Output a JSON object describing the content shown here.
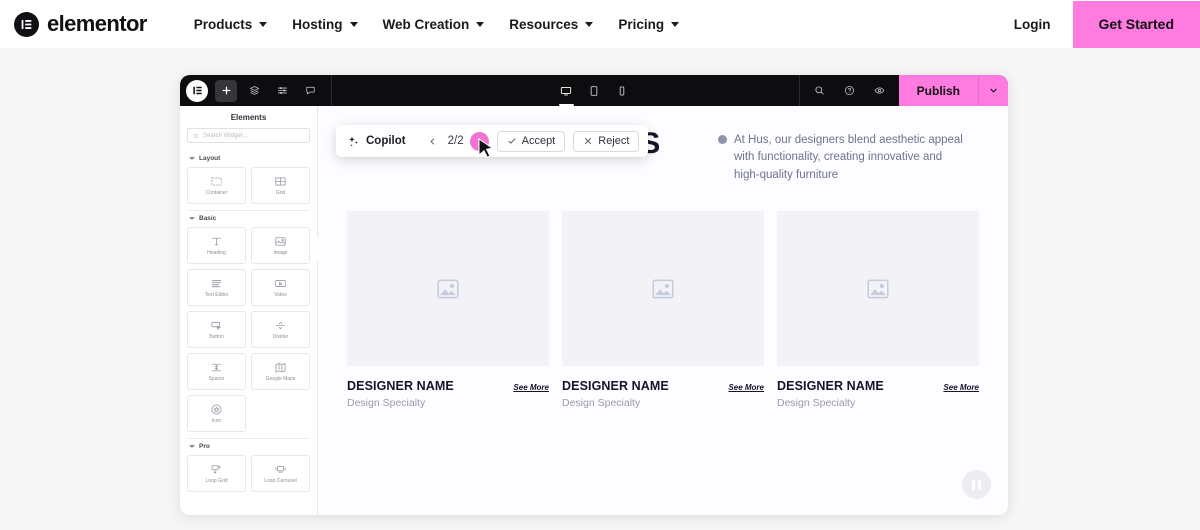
{
  "site_header": {
    "brand_name": "elementor",
    "brand_icon": "elementor-logo-icon",
    "nav": [
      {
        "label": "Products",
        "icon": "chevron-down-icon"
      },
      {
        "label": "Hosting",
        "icon": "chevron-down-icon"
      },
      {
        "label": "Web Creation",
        "icon": "chevron-down-icon"
      },
      {
        "label": "Resources",
        "icon": "chevron-down-icon"
      },
      {
        "label": "Pricing",
        "icon": "chevron-down-icon"
      }
    ],
    "login_label": "Login",
    "cta_label": "Get Started",
    "cta_color": "#ff7bdf"
  },
  "editor": {
    "topbar": {
      "logo_icon": "elementor-logo-icon",
      "add_icon": "plus-icon",
      "structure_icon": "layers-icon",
      "settings_icon": "sliders-icon",
      "comments_icon": "comment-bubble-icon",
      "devices": [
        {
          "name": "desktop",
          "icon": "desktop-icon",
          "active": true
        },
        {
          "name": "tablet",
          "icon": "tablet-icon",
          "active": false
        },
        {
          "name": "mobile",
          "icon": "mobile-icon",
          "active": false
        }
      ],
      "search_icon": "search-icon",
      "help_icon": "question-circle-icon",
      "preview_icon": "eye-icon",
      "publish_label": "Publish",
      "publish_caret_icon": "chevron-down-icon",
      "publish_color": "#ff7bdf"
    },
    "panel": {
      "title": "Elements",
      "search_placeholder": "Search Widget...",
      "search_icon": "search-icon",
      "collapse_icon": "chevron-left-icon",
      "sections": [
        {
          "title": "Layout",
          "widgets": [
            {
              "label": "Container",
              "icon": "container-icon"
            },
            {
              "label": "Grid",
              "icon": "grid-icon"
            }
          ]
        },
        {
          "title": "Basic",
          "widgets": [
            {
              "label": "Heading",
              "icon": "heading-icon"
            },
            {
              "label": "Image",
              "icon": "image-icon"
            },
            {
              "label": "Text Editor",
              "icon": "text-editor-icon"
            },
            {
              "label": "Video",
              "icon": "video-icon"
            },
            {
              "label": "Button",
              "icon": "button-icon"
            },
            {
              "label": "Divider",
              "icon": "divider-icon"
            },
            {
              "label": "Spacer",
              "icon": "spacer-icon"
            },
            {
              "label": "Google Maps",
              "icon": "google-maps-icon"
            },
            {
              "label": "Icon",
              "icon": "star-icon"
            }
          ]
        },
        {
          "title": "Pro",
          "widgets": [
            {
              "label": "Loop Grid",
              "icon": "loop-grid-icon"
            },
            {
              "label": "Loop Carousel",
              "icon": "loop-carousel-icon"
            }
          ]
        }
      ]
    },
    "canvas": {
      "hero_title": "DESIGNER PROFILES",
      "hero_paragraph": "At Hus, our designers blend aesthetic appeal with functionality, creating innovative and high-quality furniture",
      "cards": [
        {
          "name": "DESIGNER NAME",
          "specialty": "Design Specialty",
          "more_label": "See More",
          "image_icon": "image-placeholder-icon"
        },
        {
          "name": "DESIGNER NAME",
          "specialty": "Design Specialty",
          "more_label": "See More",
          "image_icon": "image-placeholder-icon"
        },
        {
          "name": "DESIGNER NAME",
          "specialty": "Design Specialty",
          "more_label": "See More",
          "image_icon": "image-placeholder-icon"
        }
      ],
      "pause_icon": "pause-icon"
    },
    "copilot": {
      "label": "Copilot",
      "sparkle_icon": "sparkle-icon",
      "prev_icon": "chevron-left-icon",
      "next_icon": "chevron-right-icon",
      "counter": "2/2",
      "accept_label": "Accept",
      "accept_icon": "check-icon",
      "reject_label": "Reject",
      "reject_icon": "close-x-icon",
      "hover_color": "#f472d0",
      "cursor_icon": "mouse-pointer-icon"
    }
  }
}
